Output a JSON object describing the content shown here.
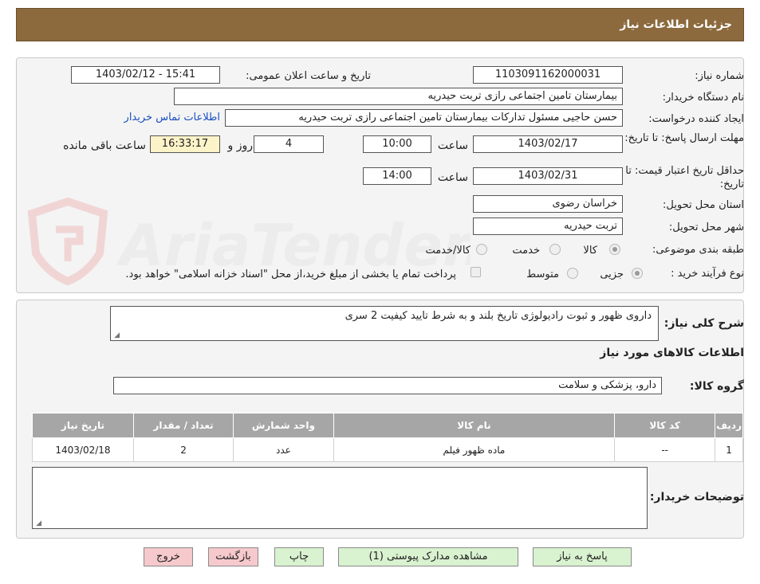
{
  "header": {
    "title": "جزئیات اطلاعات نیاز"
  },
  "info": {
    "need_number_label": "شماره نیاز:",
    "need_number": "1103091162000031",
    "announce_label": "تاریخ و ساعت اعلان عمومی:",
    "announce_value": "1403/02/12 - 15:41",
    "buyer_org_label": "نام دستگاه خریدار:",
    "buyer_org": "بیمارستان تامین اجتماعی رازی تربت حیدریه",
    "creator_label": "ایجاد کننده درخواست:",
    "creator": "حسن حاجیی مسئول تدارکات بیمارستان تامین اجتماعی رازی تربت حیدریه",
    "contact_link": "اطلاعات تماس خریدار",
    "deadline_label": "مهلت ارسال پاسخ: تا تاریخ:",
    "deadline_date": "1403/02/17",
    "time_label": "ساعت",
    "deadline_time": "10:00",
    "days_value": "4",
    "days_label": "روز و",
    "remaining_time": "16:33:17",
    "remaining_label": "ساعت باقی مانده",
    "validity_label": "حداقل تاریخ اعتبار قیمت: تا تاریخ:",
    "validity_date": "1403/02/31",
    "validity_time": "14:00",
    "province_label": "استان محل تحویل:",
    "province": "خراسان رضوی",
    "city_label": "شهر محل تحویل:",
    "city": "تربت حیدریه",
    "category_label": "طبقه بندی موضوعی:",
    "category_options": [
      "کالا",
      "خدمت",
      "کالا/خدمت"
    ],
    "category_selected": "کالا",
    "process_label": "نوع فرآیند خرید :",
    "process_options": [
      "جزیی",
      "متوسط"
    ],
    "process_selected": "جزیی",
    "payment_note": "پرداخت تمام یا بخشی از مبلغ خرید،از محل \"اسناد خزانه اسلامی\" خواهد بود."
  },
  "needs": {
    "summary_label": "شرح کلی نیاز:",
    "summary": "داروی ظهور و ثبوت رادیولوژی تاریخ بلند و به شرط تایید کیفیت 2 سری",
    "goods_info_title": "اطلاعات کالاهای مورد نیاز",
    "goods_group_label": "گروه کالا:",
    "goods_group": "دارو، پزشکی و سلامت",
    "table": {
      "headers": [
        "ردیف",
        "کد کالا",
        "نام کالا",
        "واحد شمارش",
        "تعداد / مقدار",
        "تاریخ نیاز"
      ],
      "rows": [
        [
          "1",
          "--",
          "ماده ظهور فیلم",
          "عدد",
          "2",
          "1403/02/18"
        ]
      ]
    },
    "buyer_notes_label": "توضیحات خریدار:",
    "buyer_notes": ""
  },
  "buttons": {
    "reply": "پاسخ به نیاز",
    "attachments": "مشاهده مدارک پیوستی (1)",
    "print": "چاپ",
    "back": "بازگشت",
    "exit": "خروج"
  },
  "watermark": {
    "text": "AriaTender.neT"
  },
  "colors": {
    "header": "#8c6a3e",
    "table_header": "#a6a6a6",
    "green_button": "#d9f2d0",
    "red_button": "#f6c9cc",
    "remaining_bg": "#fdf3c8",
    "link": "#1a4fc2"
  }
}
